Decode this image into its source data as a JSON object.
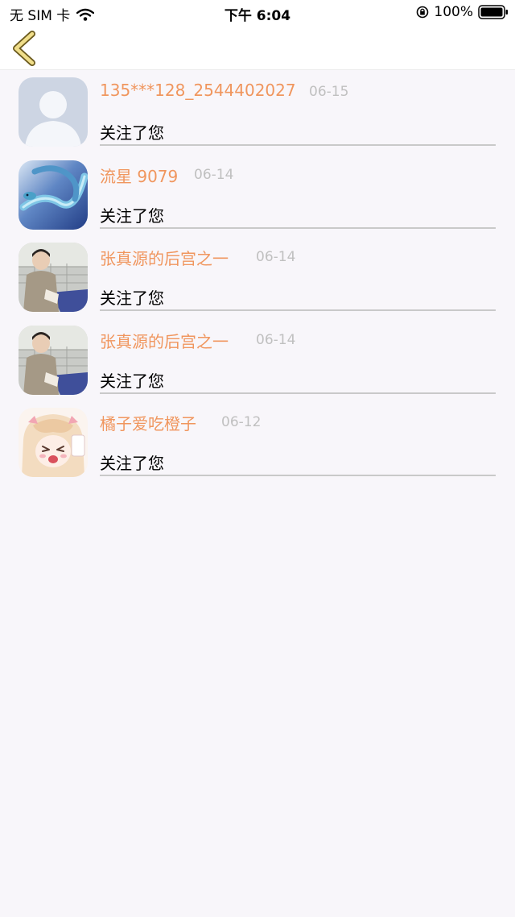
{
  "status_bar": {
    "carrier": "无 SIM 卡",
    "time": "下午 6:04",
    "battery": "100%"
  },
  "icons": {
    "back": "chevron-left-icon",
    "wifi": "wifi-icon",
    "lock": "orientation-lock-icon",
    "battery": "battery-icon"
  },
  "colors": {
    "name": "#f0965e",
    "date": "#c0c0c0",
    "back_arrow": "#f0de8a"
  },
  "notifications": [
    {
      "name": "135***128_2544402027",
      "date": "06-15",
      "message": "关注了您",
      "avatar": "default-avatar"
    },
    {
      "name": "流星 9079",
      "date": "06-14",
      "message": "关注了您",
      "avatar": "snake-avatar"
    },
    {
      "name": "张真源的后宫之一",
      "date": "06-14",
      "message": "关注了您",
      "avatar": "person-avatar"
    },
    {
      "name": "张真源的后宫之一",
      "date": "06-14",
      "message": "关注了您",
      "avatar": "person-avatar"
    },
    {
      "name": "橘子爱吃橙子",
      "date": "06-12",
      "message": "关注了您",
      "avatar": "anime-avatar"
    }
  ]
}
